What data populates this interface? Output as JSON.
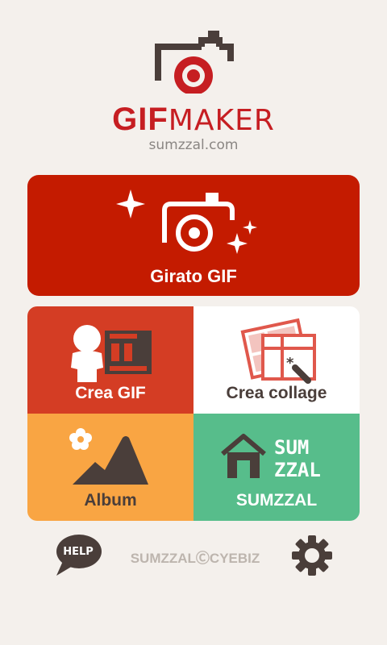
{
  "app": {
    "brand_gif": "GIF",
    "brand_maker": "MAKER",
    "site": "sumzzal.com"
  },
  "main": {
    "record_label": "Girato GIF"
  },
  "grid": {
    "make_gif": "Crea GIF",
    "collage": "Crea collage",
    "album": "Album",
    "sumzzal": "SUMZZAL",
    "sumzzal_logo_line1": "SUM",
    "sumzzal_logo_line2": "ZZAL"
  },
  "footer": {
    "help": "HELP",
    "copyright": "SUMZZALⒸCYEBIZ"
  },
  "colors": {
    "background": "#f4f0ec",
    "brand_red": "#c61e22",
    "record_bg": "#c41b00",
    "make_gif_bg": "#d43d24",
    "collage_bg": "#ffffff",
    "album_bg": "#f9a543",
    "sumzzal_bg": "#57bd8b",
    "icon_dark": "#4a3e3a"
  },
  "icons": {
    "logo": "camera-logo-icon",
    "record": "camera-sparkle-icon",
    "make_gif": "person-film-icon",
    "collage": "photo-collage-icon",
    "album": "mountain-album-icon",
    "sumzzal": "house-icon",
    "help": "speech-bubble-icon",
    "settings": "gear-icon"
  }
}
